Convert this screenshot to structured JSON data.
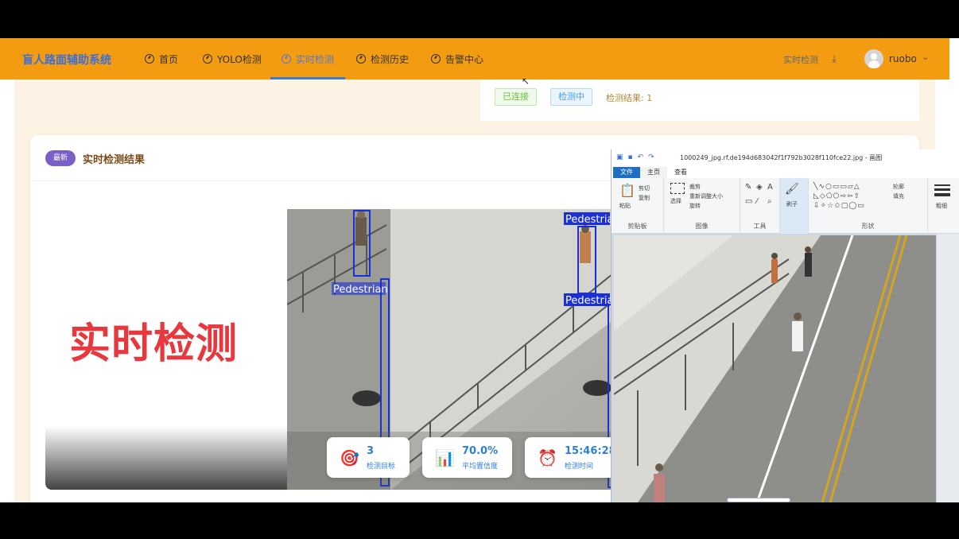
{
  "app": {
    "brand": "盲人路面辅助系统",
    "nav": [
      {
        "label": "首页",
        "icon": "dashboard-icon"
      },
      {
        "label": "YOLO检测",
        "icon": "dashboard-icon"
      },
      {
        "label": "实时检测",
        "icon": "dashboard-icon",
        "active": true
      },
      {
        "label": "检测历史",
        "icon": "dashboard-icon"
      },
      {
        "label": "告警中心",
        "icon": "dashboard-icon"
      }
    ],
    "right_label": "实时检测",
    "right_icon": "download-icon",
    "username": "ruobo"
  },
  "status": {
    "connected": "已连接",
    "detecting": "检测中",
    "result": "检测结果: 1"
  },
  "result_card": {
    "badge": "最新",
    "title": "实时检测结果",
    "overlay_label": "实时检测",
    "detection_label": "Pedestrian",
    "stats": [
      {
        "icon": "target-icon",
        "value": "3",
        "label": "检测目标"
      },
      {
        "icon": "bar-chart-icon",
        "value": "70.0%",
        "label": "平均置信度"
      },
      {
        "icon": "alarm-clock-icon",
        "value": "15:46:28",
        "label": "检测时间"
      }
    ]
  },
  "paint": {
    "title": "1000249_jpg.rf.de194d683042f1f792b3028f110fce22.jpg - 画图",
    "tabs": {
      "file": "文件",
      "home": "主页",
      "view": "查看"
    },
    "groups": {
      "clipboard": {
        "label": "剪贴板",
        "paste": "粘贴",
        "cut": "剪切",
        "copy": "复制"
      },
      "image": {
        "label": "图像",
        "select": "选择",
        "crop": "裁剪",
        "resize": "重新调整大小",
        "rotate": "旋转"
      },
      "tools": {
        "label": "工具"
      },
      "brushes": {
        "label": "刷子"
      },
      "shapes": {
        "label": "形状",
        "outline": "轮廓",
        "fill": "填充"
      },
      "size": {
        "label": "粗细"
      }
    }
  }
}
